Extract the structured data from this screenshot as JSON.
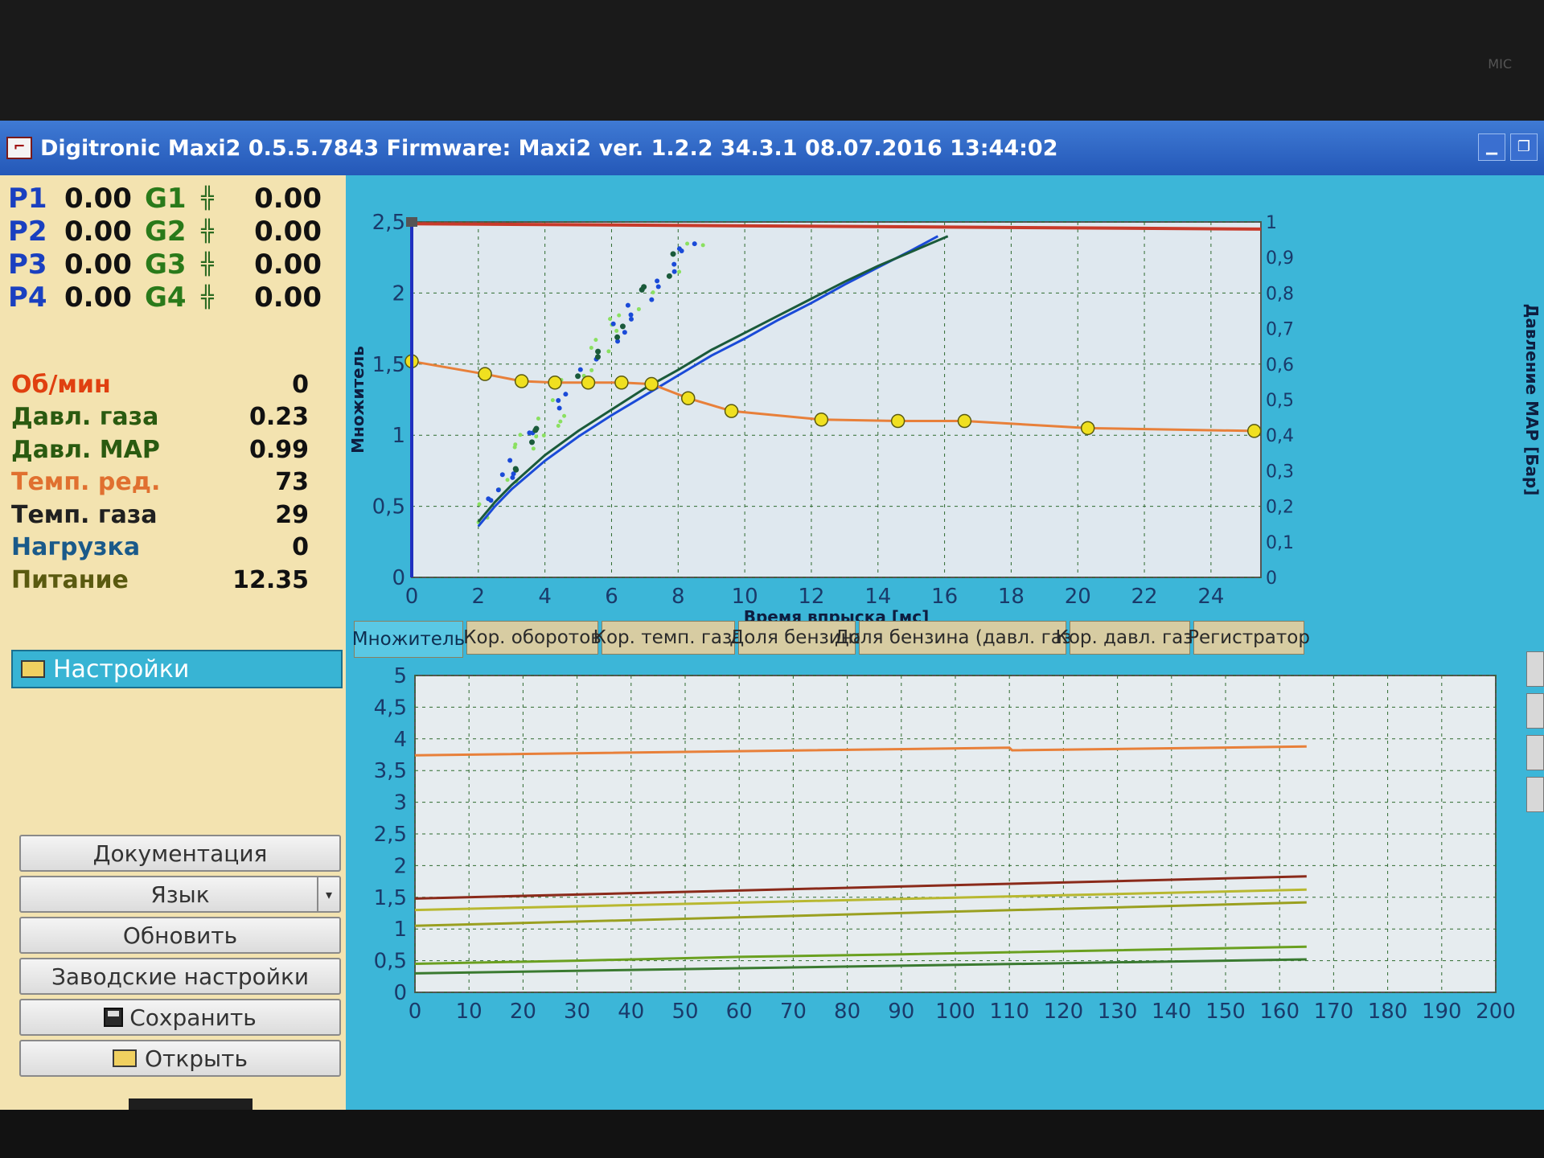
{
  "title_bar": {
    "title": "Digitronic Maxi2 0.5.5.7843 Firmware: Maxi2 ver. 1.2.2 34.3.1 08.07.2016 13:44:02",
    "app_icon_glyph": "⌐",
    "minimize_glyph": "▁",
    "restore_glyph": "❐"
  },
  "bezel": {
    "mic_label": "MIC"
  },
  "sensors": [
    {
      "p_label": "P1",
      "p_value": "0.00",
      "g_label": "G1",
      "g_value": "0.00"
    },
    {
      "p_label": "P2",
      "p_value": "0.00",
      "g_label": "G2",
      "g_value": "0.00"
    },
    {
      "p_label": "P3",
      "p_value": "0.00",
      "g_label": "G3",
      "g_value": "0.00"
    },
    {
      "p_label": "P4",
      "p_value": "0.00",
      "g_label": "G4",
      "g_value": "0.00"
    }
  ],
  "injector_icon": "injector-icon",
  "injector_glyph": "╬",
  "params": [
    {
      "label": "Об/мин",
      "value": "0"
    },
    {
      "label": "Давл. газа",
      "value": "0.23"
    },
    {
      "label": "Давл. MAP",
      "value": "0.99"
    },
    {
      "label": "Темп. ред.",
      "value": "73"
    },
    {
      "label": "Темп. газа",
      "value": "29"
    },
    {
      "label": "Нагрузка",
      "value": "0"
    },
    {
      "label": "Питание",
      "value": "12.35"
    }
  ],
  "settings": {
    "label": "Настройки"
  },
  "buttons": {
    "documentation": "Документация",
    "language": "Язык",
    "language_arrow": "▾",
    "refresh": "Обновить",
    "factory": "Заводские настройки",
    "save": "Сохранить",
    "open": "Открыть"
  },
  "colors": {
    "accent": "#3cb6d8",
    "multiplier_curve": "#e8803a",
    "marker": "#f0e020",
    "map_line": "#c83a2a",
    "blue_series": "#1a4ad8",
    "dark_series": "#1a5a3a",
    "light_points": "#8ae060"
  },
  "tabs": [
    "Множитель",
    "Кор. оборотов",
    "Кор. темп. газа",
    "Доля бензина",
    "Доля бензина (давл. газа)",
    "Кор. давл. газа",
    "Регистратор"
  ],
  "chart_data": [
    {
      "type": "line",
      "xlabel": "Время впрыска [мс]",
      "ylabel": "Множитель",
      "y2label": "Давление MAP [Бар]",
      "xlim": [
        0,
        25.5
      ],
      "ylim": [
        0,
        2.5
      ],
      "y2lim": [
        0,
        1
      ],
      "x_ticks": [
        "0",
        "2",
        "4",
        "6",
        "8",
        "10",
        "12",
        "14",
        "16",
        "18",
        "20",
        "22",
        "24"
      ],
      "y_ticks": [
        "0",
        "0,5",
        "1",
        "1,5",
        "2",
        "2,5"
      ],
      "y2_ticks": [
        "0",
        "0,1",
        "0,2",
        "0,3",
        "0,4",
        "0,5",
        "0,6",
        "0,7",
        "0,8",
        "0,9",
        "1"
      ],
      "grid": true,
      "multiplier_points": [
        [
          0,
          1.52
        ],
        [
          2.2,
          1.43
        ],
        [
          3.3,
          1.38
        ],
        [
          4.3,
          1.37
        ],
        [
          5.3,
          1.37
        ],
        [
          6.3,
          1.37
        ],
        [
          7.2,
          1.36
        ],
        [
          8.3,
          1.26
        ],
        [
          9.6,
          1.17
        ],
        [
          12.3,
          1.11
        ],
        [
          14.6,
          1.1
        ],
        [
          16.6,
          1.1
        ],
        [
          20.3,
          1.05
        ],
        [
          25.3,
          1.03
        ]
      ],
      "map_line": [
        [
          0,
          0.995
        ],
        [
          25.5,
          0.98
        ]
      ],
      "blue_trend": [
        [
          2.0,
          0.36
        ],
        [
          2.5,
          0.5
        ],
        [
          3.0,
          0.62
        ],
        [
          4.0,
          0.82
        ],
        [
          5.0,
          0.99
        ],
        [
          6.0,
          1.14
        ],
        [
          7.0,
          1.28
        ],
        [
          8.0,
          1.42
        ],
        [
          9.0,
          1.56
        ],
        [
          10.0,
          1.68
        ],
        [
          11.0,
          1.81
        ],
        [
          12.0,
          1.93
        ],
        [
          13.0,
          2.06
        ],
        [
          14.0,
          2.18
        ],
        [
          15.0,
          2.3
        ],
        [
          15.8,
          2.4
        ]
      ],
      "dark_trend": [
        [
          2.0,
          0.39
        ],
        [
          2.5,
          0.53
        ],
        [
          3.0,
          0.65
        ],
        [
          4.0,
          0.86
        ],
        [
          5.0,
          1.03
        ],
        [
          6.0,
          1.18
        ],
        [
          7.0,
          1.33
        ],
        [
          8.0,
          1.46
        ],
        [
          9.0,
          1.6
        ],
        [
          10.0,
          1.72
        ],
        [
          11.0,
          1.84
        ],
        [
          12.0,
          1.96
        ],
        [
          13.0,
          2.08
        ],
        [
          14.0,
          2.19
        ],
        [
          15.0,
          2.29
        ],
        [
          16.1,
          2.4
        ]
      ]
    },
    {
      "type": "line",
      "xlim": [
        0,
        200
      ],
      "ylim": [
        0,
        5
      ],
      "x_ticks": [
        "0",
        "10",
        "20",
        "30",
        "40",
        "50",
        "60",
        "70",
        "80",
        "90",
        "100",
        "110",
        "120",
        "130",
        "140",
        "150",
        "160",
        "170",
        "180",
        "190",
        "200"
      ],
      "y_ticks": [
        "0",
        "0,5",
        "1",
        "1,5",
        "2",
        "2,5",
        "3",
        "3,5",
        "4",
        "4,5",
        "5"
      ],
      "grid": true,
      "series": [
        {
          "color": "#e8803a",
          "points": [
            [
              0,
              3.74
            ],
            [
              110,
              3.86
            ],
            [
              110.5,
              3.82
            ],
            [
              165,
              3.88
            ]
          ]
        },
        {
          "color": "#8a2a1a",
          "points": [
            [
              0,
              1.48
            ],
            [
              165,
              1.83
            ]
          ]
        },
        {
          "color": "#b8b830",
          "points": [
            [
              0,
              1.3
            ],
            [
              165,
              1.62
            ]
          ]
        },
        {
          "color": "#9aa020",
          "points": [
            [
              0,
              1.05
            ],
            [
              165,
              1.42
            ]
          ]
        },
        {
          "color": "#6aa020",
          "points": [
            [
              0,
              0.45
            ],
            [
              30,
              0.5
            ],
            [
              60,
              0.56
            ],
            [
              90,
              0.6
            ],
            [
              165,
              0.72
            ]
          ]
        },
        {
          "color": "#3a7a30",
          "points": [
            [
              0,
              0.3
            ],
            [
              165,
              0.52
            ]
          ]
        }
      ]
    }
  ]
}
